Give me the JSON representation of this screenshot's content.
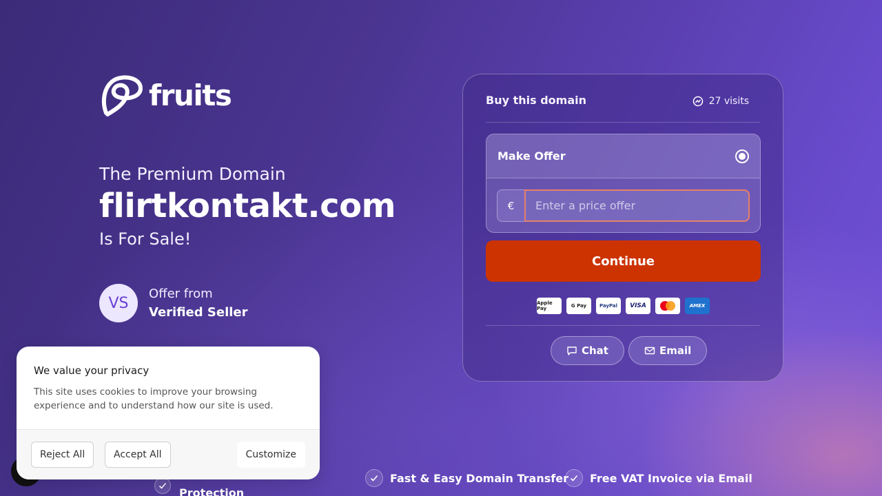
{
  "brand": {
    "name": "fruits",
    "logo_icon": "fruits-logo-icon"
  },
  "hero": {
    "subtitle": "The Premium Domain",
    "domain": "flirtkontakt.com",
    "tagline": "Is For Sale!"
  },
  "seller": {
    "initials": "VS",
    "label": "Offer from",
    "name": "Verified Seller"
  },
  "card": {
    "title": "Buy this domain",
    "visits": "27 visits",
    "offer_label": "Make Offer",
    "currency": "€",
    "price_placeholder": "Enter a price offer",
    "continue_label": "Continue",
    "payment_methods": [
      "Apple Pay",
      "G Pay",
      "PayPal",
      "VISA",
      "Mastercard",
      "AMEX"
    ],
    "chat_label": "Chat",
    "email_label": "Email"
  },
  "features": [
    {
      "label": "Protection"
    },
    {
      "label": "Fast & Easy Domain Transfer"
    },
    {
      "label": "Free VAT Invoice via Email"
    }
  ],
  "cookie": {
    "title": "We value your privacy",
    "text": "This site uses cookies to improve your browsing experience and to understand how our site is used.",
    "reject_label": "Reject All",
    "accept_label": "Accept All",
    "customize_label": "Customize"
  },
  "colors": {
    "accent": "#cc3300",
    "input_border": "#e8806a",
    "avatar_text": "#6a3fd6"
  }
}
